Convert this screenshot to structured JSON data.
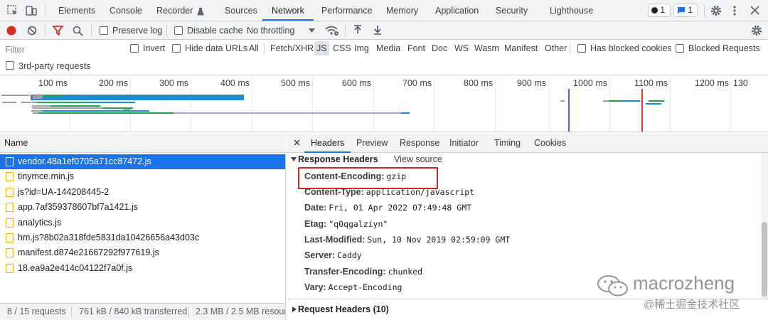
{
  "tabbar": {
    "tabs": [
      {
        "label": "Elements"
      },
      {
        "label": "Console"
      },
      {
        "label": "Recorder"
      },
      {
        "label": "Sources"
      },
      {
        "label": "Network"
      },
      {
        "label": "Performance"
      },
      {
        "label": "Memory"
      },
      {
        "label": "Application"
      },
      {
        "label": "Security"
      },
      {
        "label": "Lighthouse"
      }
    ],
    "active_tab": "Network",
    "error_count": "1",
    "message_count": "1"
  },
  "toolbar": {
    "preserve_log_label": "Preserve log",
    "preserve_log_checked": false,
    "disable_cache_label": "Disable cache",
    "disable_cache_checked": false,
    "throttling_value": "No throttling"
  },
  "filterbar": {
    "filter_placeholder": "Filter",
    "invert_label": "Invert",
    "hide_data_urls_label": "Hide data URLs",
    "types": [
      "All",
      "Fetch/XHR",
      "JS",
      "CSS",
      "Img",
      "Media",
      "Font",
      "Doc",
      "WS",
      "Wasm",
      "Manifest",
      "Other"
    ],
    "active_type": "JS",
    "has_blocked_cookies_label": "Has blocked cookies",
    "blocked_requests_label": "Blocked Requests",
    "third_party_label": "3rd-party requests"
  },
  "overview": {
    "ticks": [
      "100 ms",
      "200 ms",
      "300 ms",
      "400 ms",
      "500 ms",
      "600 ms",
      "700 ms",
      "800 ms",
      "900 ms",
      "1000 ms",
      "1100 ms",
      "1200 ms",
      "130"
    ]
  },
  "requests": {
    "column_name": "Name",
    "items": [
      {
        "name": "vendor.48a1ef0705a71cc87472.js"
      },
      {
        "name": "tinymce.min.js"
      },
      {
        "name": "js?id=UA-144208445-2"
      },
      {
        "name": "app.7af359378607bf7a1421.js"
      },
      {
        "name": "analytics.js"
      },
      {
        "name": "hm.js?8b02a318fde5831da10426656a43d03c"
      },
      {
        "name": "manifest.d874e21667292f977619.js"
      },
      {
        "name": "18.ea9a2e414c04122f7a0f.js"
      }
    ],
    "selected_index": 0
  },
  "statusbar": {
    "requests": "8 / 15 requests",
    "transferred": "761 kB / 840 kB transferred",
    "resources": "2.3 MB / 2.5 MB resour"
  },
  "details": {
    "tabs": [
      {
        "label": "Headers"
      },
      {
        "label": "Preview"
      },
      {
        "label": "Response"
      },
      {
        "label": "Initiator"
      },
      {
        "label": "Timing"
      },
      {
        "label": "Cookies"
      }
    ],
    "active_tab": "Headers",
    "response_headers_title": "Response Headers",
    "view_source_label": "View source",
    "response_headers": [
      {
        "name": "Content-Encoding:",
        "value": "gzip"
      },
      {
        "name": "Content-Type:",
        "value": "application/javascript"
      },
      {
        "name": "Date:",
        "value": "Fri, 01 Apr 2022 07:49:48 GMT"
      },
      {
        "name": "Etag:",
        "value": "\"q0qgalziyn\""
      },
      {
        "name": "Last-Modified:",
        "value": "Sun, 10 Nov 2019 02:59:09 GMT"
      },
      {
        "name": "Server:",
        "value": "Caddy"
      },
      {
        "name": "Transfer-Encoding:",
        "value": "chunked"
      },
      {
        "name": "Vary:",
        "value": "Accept-Encoding"
      }
    ],
    "request_headers_title": "Request Headers (10)"
  },
  "watermark": {
    "author": "macrozheng",
    "site": "@稀土掘金技术社区"
  },
  "colors": {
    "accent": "#1a73e8",
    "record_red": "#d93025",
    "filter_red": "#d93025",
    "highlight_box": "#e02020",
    "file_icon": "#f2b100"
  }
}
